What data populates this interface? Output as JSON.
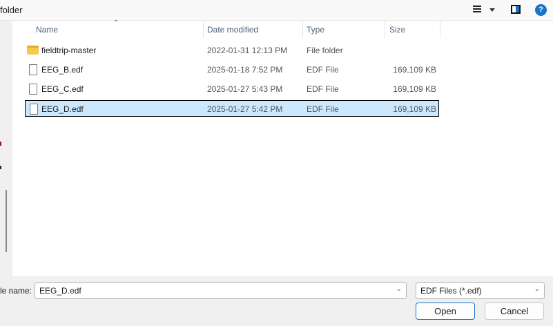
{
  "title": "folder",
  "toolbar": {
    "view_icon": "list-view-icon",
    "preview_icon": "preview-pane-icon",
    "help_icon": "help-icon"
  },
  "columns": {
    "name": "Name",
    "date": "Date modified",
    "type": "Type",
    "size": "Size"
  },
  "files": [
    {
      "name": "fieldtrip-master",
      "date": "2022-01-31 12:13 PM",
      "type": "File folder",
      "size": ""
    },
    {
      "name": "EEG_B.edf",
      "date": "2025-01-18 7:52 PM",
      "type": "EDF File",
      "size": "169,109 KB"
    },
    {
      "name": "EEG_C.edf",
      "date": "2025-01-27 5:43 PM",
      "type": "EDF File",
      "size": "169,109 KB"
    },
    {
      "name": "EEG_D.edf",
      "date": "2025-01-27 5:42 PM",
      "type": "EDF File",
      "size": "169,109 KB"
    }
  ],
  "footer": {
    "file_name_label": "le name:",
    "file_name_value": "EEG_D.edf",
    "filter": "EDF Files (*.edf)",
    "open": "Open",
    "cancel": "Cancel"
  },
  "colors": {
    "selection": "#cce8ff",
    "help": "#1a73c8"
  }
}
